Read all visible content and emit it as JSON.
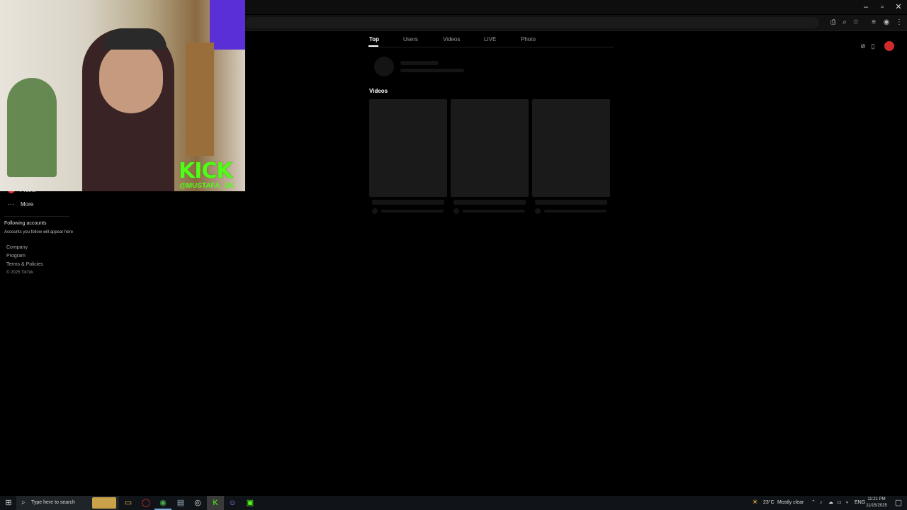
{
  "browser": {
    "window_controls": {
      "minimize": "–",
      "maximize": "▫",
      "close": "✕"
    },
    "toolbar_icons": [
      "install-app-icon",
      "zoom-icon",
      "star-icon",
      "extensions-icon",
      "profile-icon",
      "menu-icon"
    ]
  },
  "webcam": {
    "brand": "KICK",
    "handle": "@MUSTAFA_OK"
  },
  "sidebar": {
    "profile_label": "Profile",
    "more_label": "More",
    "following_title": "Following accounts",
    "following_hint": "Accounts you follow will appear here",
    "links": [
      "Company",
      "Program",
      "Terms & Policies"
    ],
    "copyright": "© 2025 TikTok"
  },
  "search": {
    "tabs": [
      "Top",
      "Users",
      "Videos",
      "LIVE",
      "Photo"
    ],
    "active_tab": "Top",
    "videos_heading": "Videos"
  },
  "taskbar": {
    "search_placeholder": "Type here to search",
    "weather_temp": "23°C",
    "weather_desc": "Mostly clear",
    "time": "11:21 PM",
    "date": "11/15/2025",
    "lang": "ENG"
  },
  "colors": {
    "kick_green": "#53fc18",
    "background": "#000000",
    "skeleton": "#1a1a1a"
  }
}
